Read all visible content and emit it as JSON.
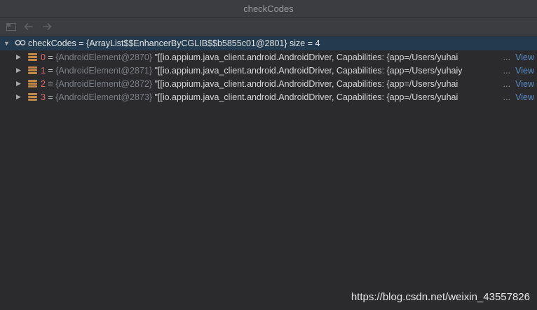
{
  "window": {
    "title": "checkCodes"
  },
  "toolbar": {
    "icons": [
      "restore-layout-icon",
      "back-arrow-icon",
      "forward-arrow-icon"
    ]
  },
  "tree": {
    "root": {
      "name": "checkCodes",
      "label": "checkCodes = {ArrayList$$EnhancerByCGLIB$$b5855c01@2801}  size = 4"
    },
    "items": [
      {
        "index": "0",
        "eq": " = ",
        "object_id": "{AndroidElement@2870}",
        "value": " \"[[io.appium.java_client.android.AndroidDriver, Capabilities: {app=/Users/yuhai",
        "ellipsis": "...",
        "link": "View"
      },
      {
        "index": "1",
        "eq": " = ",
        "object_id": "{AndroidElement@2871}",
        "value": " \"[[io.appium.java_client.android.AndroidDriver, Capabilities: {app=/Users/yuhaiy",
        "ellipsis": "...",
        "link": "View"
      },
      {
        "index": "2",
        "eq": " = ",
        "object_id": "{AndroidElement@2872}",
        "value": " \"[[io.appium.java_client.android.AndroidDriver, Capabilities: {app=/Users/yuhai",
        "ellipsis": "...",
        "link": "View"
      },
      {
        "index": "3",
        "eq": " = ",
        "object_id": "{AndroidElement@2873}",
        "value": " \"[[io.appium.java_client.android.AndroidDriver, Capabilities: {app=/Users/yuhai",
        "ellipsis": "...",
        "link": "View"
      }
    ]
  },
  "watermark": {
    "text": "https://blog.csdn.net/weixin_43557826"
  },
  "colors": {
    "background": "#2b2b2d",
    "selection": "#233a4f",
    "index": "#e06c6c",
    "link": "#5a8dc7",
    "field_icon": "#c0894a"
  }
}
